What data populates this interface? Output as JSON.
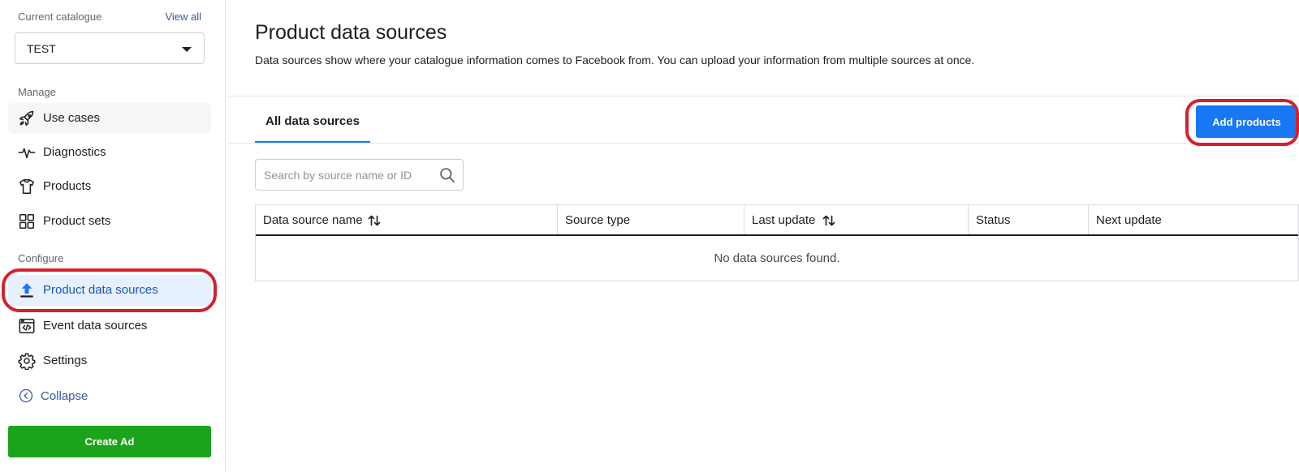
{
  "sidebar": {
    "catalogue_label": "Current catalogue",
    "view_all": "View all",
    "catalogue_value": "TEST",
    "manage_label": "Manage",
    "configure_label": "Configure",
    "items": [
      {
        "label": "Use cases",
        "icon": "rocket-icon"
      },
      {
        "label": "Diagnostics",
        "icon": "pulse-icon"
      },
      {
        "label": "Products",
        "icon": "tshirt-icon"
      },
      {
        "label": "Product sets",
        "icon": "grid-icon"
      },
      {
        "label": "Product data sources",
        "icon": "upload-icon",
        "active": true
      },
      {
        "label": "Event data sources",
        "icon": "code-window-icon"
      },
      {
        "label": "Settings",
        "icon": "gear-icon"
      }
    ],
    "collapse": "Collapse",
    "create_ad": "Create Ad"
  },
  "main": {
    "title": "Product data sources",
    "description": "Data sources show where your catalogue information comes to Facebook from. You can upload your information from multiple sources at once.",
    "tabs": [
      {
        "label": "All data sources",
        "active": true
      }
    ],
    "add_products": "Add products",
    "search": {
      "placeholder": "Search by source name or ID"
    },
    "table": {
      "columns": [
        {
          "label": "Data source name",
          "sortable": true
        },
        {
          "label": "Source type",
          "sortable": false
        },
        {
          "label": "Last update",
          "sortable": true
        },
        {
          "label": "Status",
          "sortable": false
        },
        {
          "label": "Next update",
          "sortable": false
        }
      ],
      "empty_message": "No data sources found."
    }
  },
  "colors": {
    "primary_blue": "#1877f2",
    "create_green": "#1aa41a",
    "highlight_red": "#d3212d",
    "active_bg": "#e7f0fd"
  }
}
